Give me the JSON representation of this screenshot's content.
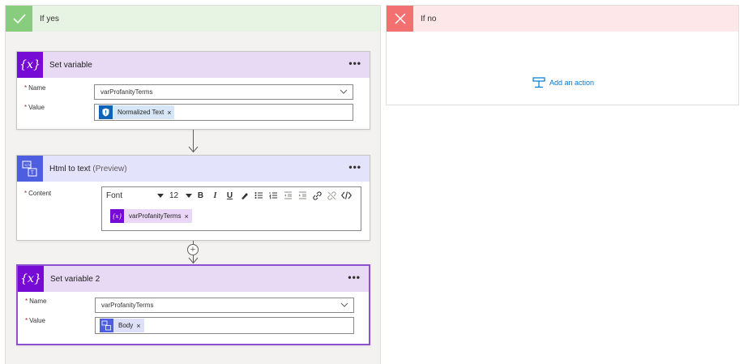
{
  "yes_branch": {
    "title": "If yes",
    "icon": "checkmark-icon",
    "color": "#88cc7e"
  },
  "no_branch": {
    "title": "If no",
    "icon": "close-icon",
    "color": "#f2706f",
    "add_action_label": "Add an action"
  },
  "set_variable": {
    "title": "Set variable",
    "icon": "variable-icon",
    "icon_glyph": "{x}",
    "name_label": "Name",
    "name_value": "varProfanityTerms",
    "value_label": "Value",
    "value_token": "Normalized Text",
    "value_token_icon": "shield-icon",
    "menu": "•••",
    "required_mark": "*",
    "remove_mark": "×"
  },
  "html_to_text": {
    "title": "Html to text",
    "preview": "(Preview)",
    "icon": "html-to-text-icon",
    "content_label": "Content",
    "toolbar": {
      "font": "Font",
      "size": "12",
      "bold": "B",
      "italic": "I",
      "underline": "U"
    },
    "content_token": "varProfanityTerms",
    "content_token_glyph": "{x}",
    "menu": "•••",
    "required_mark": "*",
    "remove_mark": "×"
  },
  "set_variable_2": {
    "title": "Set variable 2",
    "icon": "variable-icon",
    "icon_glyph": "{x}",
    "name_label": "Name",
    "name_value": "varProfanityTerms",
    "value_label": "Value",
    "value_token": "Body",
    "value_token_icon": "html-to-text-icon",
    "menu": "•••",
    "required_mark": "*",
    "remove_mark": "×",
    "selected_color": "#8f4fd1"
  },
  "connector": {
    "plus": "+"
  }
}
